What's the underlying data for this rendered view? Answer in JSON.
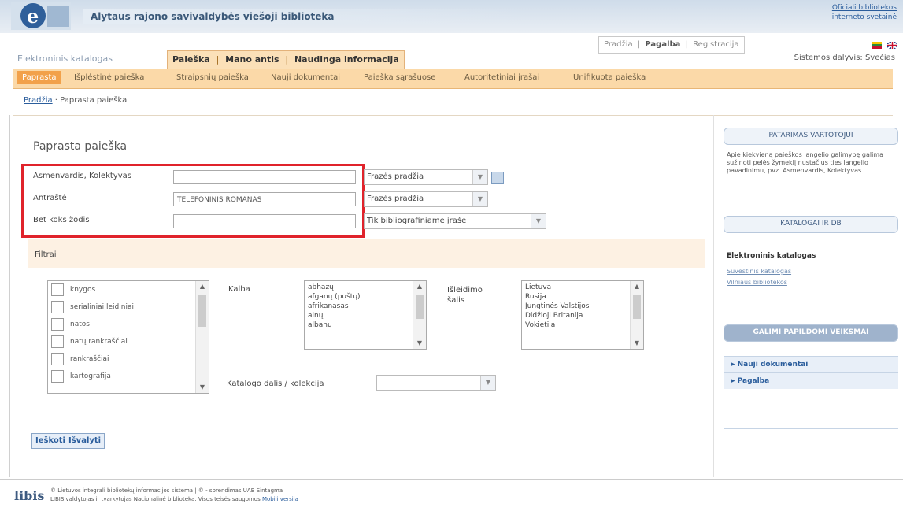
{
  "header": {
    "title": "Alytaus rajono savivaldybės viešoji biblioteka",
    "official_link_line1": "Oficiali bibliotekos",
    "official_link_line2": "interneto svetainė"
  },
  "top_links": {
    "home": "Pradžia",
    "help": "Pagalba",
    "register": "Registracija",
    "sep": "|"
  },
  "participant_label": "Sistemos dalyvis: Svečias",
  "catalog_label": "Elektroninis katalogas",
  "main_tabs": {
    "search": "Paieška",
    "my_items": "Mano antis",
    "useful": "Naudinga informacija",
    "sep": "|"
  },
  "sub_tabs": [
    "Paprasta",
    "Išplėstinė paieška",
    "Straipsnių paieška",
    "Nauji dokumentai",
    "Paieška sąrašuose",
    "Autoritetiniai įrašai",
    "Unifikuota paieška"
  ],
  "breadcrumb": {
    "home": "Pradžia",
    "current": "· Paprasta paieška"
  },
  "search": {
    "heading": "Paprasta paieška",
    "fields": [
      {
        "label": "Asmenvardis, Kolektyvas",
        "value": "",
        "mode": "Frazės pradžia"
      },
      {
        "label": "Antraštė",
        "value": "TELEFONINIS ROMANAS",
        "mode": "Frazės pradžia"
      },
      {
        "label": "Bet koks žodis",
        "value": "",
        "mode": "Tik bibliografiniame įraše"
      }
    ]
  },
  "filters": {
    "label": "Filtrai",
    "types": [
      "knygos",
      "serialiniai leidiniai",
      "natos",
      "natų rankraščiai",
      "rankraščiai",
      "kartografija"
    ],
    "language_label": "Kalba",
    "languages": [
      "abhazų",
      "afganų (puštų)",
      "afrikanasas",
      "ainų",
      "albanų"
    ],
    "country_label_line1": "Išleidimo",
    "country_label_line2": "šalis",
    "countries": [
      "Lietuva",
      "Rusija",
      "Jungtinės Valstijos",
      "Didžioji Britanija",
      "Vokietija"
    ],
    "collection_label": "Katalogo dalis / kolekcija",
    "collection_value": ""
  },
  "buttons": {
    "search": "Ieškoti",
    "clear": "Išvalyti"
  },
  "sidebar": {
    "tip_heading": "PATARIMAS VARTOTOJUI",
    "tip_text": "Apie kiekvieną paieškos langelio galimybę galima sužinoti pelės žymeklį nustačius ties langelio pavadinimu, pvz. Asmenvardis, Kolektyvas.",
    "catalogs_heading": "KATALOGAI IR DB",
    "catalog_title": "Elektroninis katalogas",
    "catalog_links": [
      "Suvestinis katalogas",
      "Vilniaus bibliotekos"
    ],
    "actions_heading": "GALIMI PAPILDOMI VEIKSMAI",
    "actions": [
      "▸ Nauji dokumentai",
      "▸ Pagalba"
    ]
  },
  "footer": {
    "logo": "libis",
    "line1": "© Lietuvos integrali bibliotekų informacijos sistema | © - sprendimas UAB Sintagma",
    "line2": "LIBIS valdytojas ir tvarkytojas Nacionalinė biblioteka. Visos teisės saugomos",
    "mobile_link": "Mobili versija"
  },
  "colors": {
    "accent_orange": "#f2a14a",
    "highlight_red": "#e0232b",
    "link_blue": "#2a5d9c"
  }
}
